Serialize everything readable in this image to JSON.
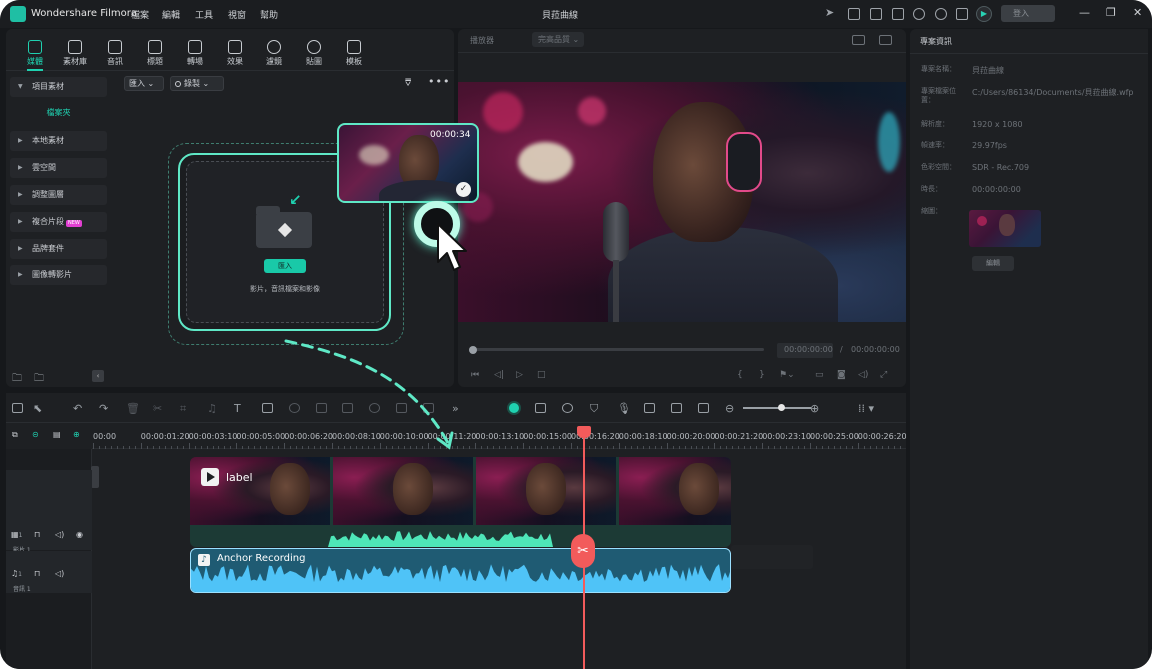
{
  "app": {
    "name": "Wondershare Filmora",
    "document_title": "貝菈曲線",
    "login_label": "登入"
  },
  "menu": [
    "檔案",
    "編輯",
    "工具",
    "視窗",
    "幫助"
  ],
  "tabs": [
    {
      "label": "媒體",
      "icon": "media-icon",
      "active": true
    },
    {
      "label": "素材庫",
      "icon": "stock-icon"
    },
    {
      "label": "音訊",
      "icon": "audio-icon"
    },
    {
      "label": "標題",
      "icon": "titles-icon"
    },
    {
      "label": "轉場",
      "icon": "transitions-icon"
    },
    {
      "label": "效果",
      "icon": "effects-icon"
    },
    {
      "label": "濾鏡",
      "icon": "filters-icon"
    },
    {
      "label": "貼圖",
      "icon": "stickers-icon"
    },
    {
      "label": "模板",
      "icon": "templates-icon"
    }
  ],
  "sidebar": {
    "project_media": "項目素材",
    "folder": "檔案夾",
    "items": [
      "本地素材",
      "雲空間",
      "調整圖層",
      "複合片段",
      "品牌套件",
      "圖像轉影片"
    ],
    "new_badge": "NEW"
  },
  "media_toolbar": {
    "import_label": "匯入",
    "record_label": "錄製"
  },
  "import_area": {
    "button": "匯入",
    "hint": "影片，音訊檔案和影像"
  },
  "floating_clip": {
    "duration": "00:00:34"
  },
  "preview": {
    "player_label": "播放器",
    "quality": "完高品質",
    "current_time": "00:00:00:00",
    "separator": "/",
    "total_time": "00:00:00:00"
  },
  "project_info": {
    "title": "專案資訊",
    "fields": [
      {
        "key": "專案名稱：",
        "value": "貝菈曲線"
      },
      {
        "key": "專案檔案位置：",
        "value": "C:/Users/86134/Documents/貝菈曲線.wfp"
      },
      {
        "key": "解析度：",
        "value": "1920 x 1080"
      },
      {
        "key": "幀速率：",
        "value": "29.97fps"
      },
      {
        "key": "色彩空間：",
        "value": "SDR - Rec.709"
      },
      {
        "key": "時長：",
        "value": "00:00:00:00"
      },
      {
        "key": "縮圖：",
        "value": ""
      }
    ],
    "edit_button": "編輯"
  },
  "timeline": {
    "ruler": [
      "00:00",
      "00:00:01:20",
      "00:00:03:10",
      "00:00:05:00",
      "00:00:06:20",
      "00:00:08:10",
      "00:00:10:00",
      "00:00:11:20",
      "00:00:13:10",
      "00:00:15:00",
      "00:00:16:20",
      "00:00:18:10",
      "00:00:20:00",
      "00:00:21:20",
      "00:00:23:10",
      "00:00:25:00",
      "00:00:26:20",
      "00:00:2"
    ],
    "video_track": {
      "name": "影片 1",
      "number": "1"
    },
    "audio_track": {
      "name": "音訊 1",
      "number": "1"
    },
    "video_clip_label": "label",
    "audio_clip_label": "Anchor Recording"
  },
  "colors": {
    "accent": "#1fd1b0",
    "playhead": "#f25b5b",
    "audio_clip": "#1f5b73",
    "audio_wave": "#4fc3f7",
    "video_wave": "#4ee6b8"
  }
}
